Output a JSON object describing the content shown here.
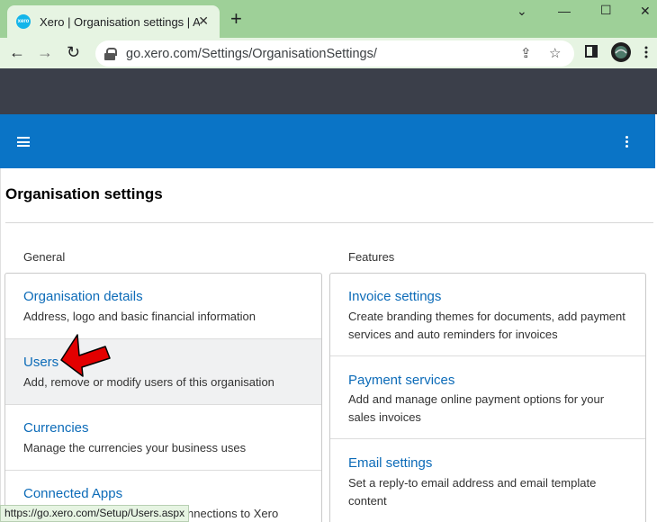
{
  "browser": {
    "tab_title": "Xero | Organisation settings | Alp",
    "favicon_text": "xero",
    "url": "go.xero.com/Settings/OrganisationSettings/",
    "status_url": "https://go.xero.com/Setup/Users.aspx",
    "chrome_color": "#9ed098"
  },
  "page": {
    "title": "Organisation settings"
  },
  "general": {
    "label": "General",
    "items": [
      {
        "title": "Organisation details",
        "desc": "Address, logo and basic financial information"
      },
      {
        "title": "Users",
        "desc": "Add, remove or modify users of this organisation"
      },
      {
        "title": "Currencies",
        "desc": "Manage the currencies your business uses"
      },
      {
        "title": "Connected Apps",
        "desc": "nnections to Xero"
      }
    ]
  },
  "features": {
    "label": "Features",
    "items": [
      {
        "title": "Invoice settings",
        "desc": "Create branding themes for documents, add payment services and auto reminders for invoices"
      },
      {
        "title": "Payment services",
        "desc": "Add and manage online payment options for your sales invoices"
      },
      {
        "title": "Email settings",
        "desc": "Set a reply-to email address and email template content"
      }
    ]
  },
  "colors": {
    "app_bar": "#0a74c6",
    "app_top": "#3b3f4a",
    "link": "#0c6bb8",
    "annotation_arrow": "#e30000"
  }
}
